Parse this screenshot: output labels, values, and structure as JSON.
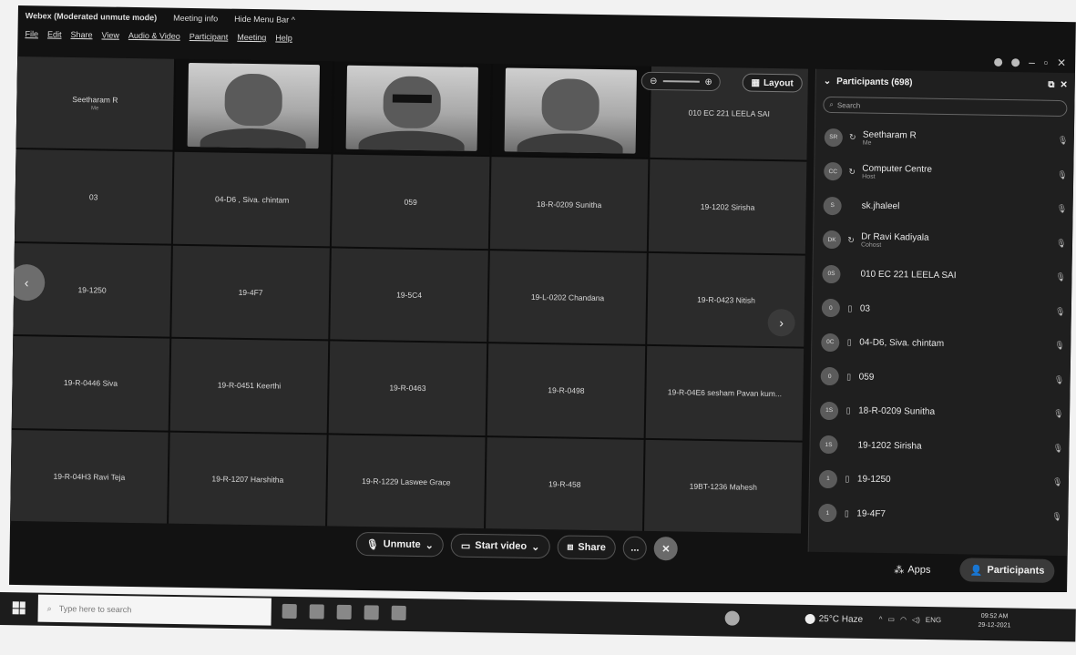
{
  "window": {
    "title": "Webex (Moderated unmute mode)",
    "meeting_info": "Meeting info",
    "hide_menu_bar": "Hide Menu Bar ^"
  },
  "menu": [
    "File",
    "Edit",
    "Share",
    "View",
    "Audio & Video",
    "Participant",
    "Meeting",
    "Help"
  ],
  "stage": {
    "layout_label": "Layout",
    "tiles": [
      {
        "name": "Seetharam R",
        "sub": "Me",
        "video": false
      },
      {
        "name": "",
        "sub": "",
        "video": true
      },
      {
        "name": "",
        "sub": "",
        "video": true,
        "glasses": true
      },
      {
        "name": "",
        "sub": "",
        "video": true
      },
      {
        "name": "010 EC 221 LEELA SAI",
        "sub": "",
        "video": false
      },
      {
        "name": "03",
        "sub": "",
        "video": false
      },
      {
        "name": "04-D6 , Siva. chintam",
        "sub": "",
        "video": false
      },
      {
        "name": "059",
        "sub": "",
        "video": false
      },
      {
        "name": "18-R-0209 Sunitha",
        "sub": "",
        "video": false
      },
      {
        "name": "19-1202 Sirisha",
        "sub": "",
        "video": false
      },
      {
        "name": "19-1250",
        "sub": "",
        "video": false
      },
      {
        "name": "19-4F7",
        "sub": "",
        "video": false
      },
      {
        "name": "19-5C4",
        "sub": "",
        "video": false
      },
      {
        "name": "19-L-0202 Chandana",
        "sub": "",
        "video": false
      },
      {
        "name": "19-R-0423 Nitish",
        "sub": "",
        "video": false
      },
      {
        "name": "19-R-0446 Siva",
        "sub": "",
        "video": false
      },
      {
        "name": "19-R-0451 Keerthi",
        "sub": "",
        "video": false
      },
      {
        "name": "19-R-0463",
        "sub": "",
        "video": false
      },
      {
        "name": "19-R-0498",
        "sub": "",
        "video": false
      },
      {
        "name": "19-R-04E6 sesham Pavan kum...",
        "sub": "",
        "video": false
      },
      {
        "name": "19-R-04H3 Ravi Teja",
        "sub": "",
        "video": false
      },
      {
        "name": "19-R-1207 Harshitha",
        "sub": "",
        "video": false
      },
      {
        "name": "19-R-1229 Laswee Grace",
        "sub": "",
        "video": false
      },
      {
        "name": "19-R-458",
        "sub": "",
        "video": false
      },
      {
        "name": "19BT-1236 Mahesh",
        "sub": "",
        "video": false
      }
    ]
  },
  "controls": {
    "unmute": "Unmute",
    "start_video": "Start video",
    "share": "Share",
    "more": "...",
    "apps": "Apps",
    "participants": "Participants"
  },
  "panel": {
    "title": "Participants (698)",
    "search_placeholder": "Search",
    "participants": [
      {
        "initials": "SR",
        "name": "Seetharam R",
        "role": "Me",
        "icon": "↻"
      },
      {
        "initials": "CC",
        "name": "Computer Centre",
        "role": "Host",
        "icon": "↻"
      },
      {
        "initials": "S",
        "name": "sk.jhaleel",
        "role": "",
        "icon": ""
      },
      {
        "initials": "DK",
        "name": "Dr Ravi Kadiyala",
        "role": "Cohost",
        "icon": "↻"
      },
      {
        "initials": "0S",
        "name": "010 EC 221 LEELA SAI",
        "role": "",
        "icon": ""
      },
      {
        "initials": "0",
        "name": "03",
        "role": "",
        "icon": "▯"
      },
      {
        "initials": "0C",
        "name": "04-D6, Siva. chintam",
        "role": "",
        "icon": "▯"
      },
      {
        "initials": "0",
        "name": "059",
        "role": "",
        "icon": "▯"
      },
      {
        "initials": "1S",
        "name": "18-R-0209 Sunitha",
        "role": "",
        "icon": "▯"
      },
      {
        "initials": "1S",
        "name": "19-1202 Sirisha",
        "role": "",
        "icon": ""
      },
      {
        "initials": "1",
        "name": "19-1250",
        "role": "",
        "icon": "▯"
      },
      {
        "initials": "1",
        "name": "19-4F7",
        "role": "",
        "icon": "▯"
      }
    ]
  },
  "taskbar": {
    "search_placeholder": "Type here to search",
    "weather": "25°C Haze",
    "lang": "ENG",
    "time": "09:52 AM",
    "date": "29-12-2021"
  }
}
